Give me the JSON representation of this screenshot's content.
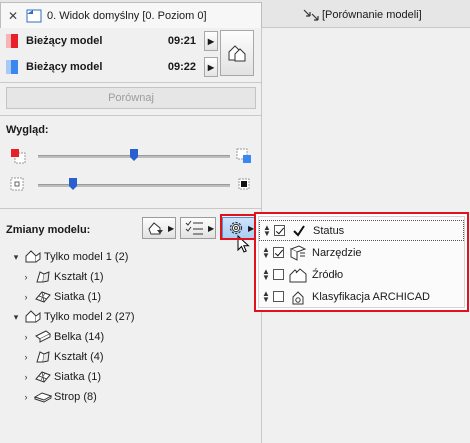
{
  "tabs": {
    "active": {
      "label": "0. Widok domyślny [0. Poziom 0]",
      "close": "✕"
    },
    "inactive": {
      "label": "[Porównanie modeli]"
    }
  },
  "models": [
    {
      "label": "Bieżący model",
      "time": "09:21",
      "color": "#e8202a"
    },
    {
      "label": "Bieżący model",
      "time": "09:22",
      "color": "#3b86f0"
    }
  ],
  "compare_button": "Porównaj",
  "appearance": {
    "label": "Wygląd:",
    "slider1": 0.5,
    "slider2": 0.18
  },
  "changes": {
    "label": "Zmiany modelu:"
  },
  "tree": [
    {
      "level": 0,
      "expand": "▾",
      "label": "Tylko model 1 (2)",
      "icon": "model-icon"
    },
    {
      "level": 1,
      "expand": "›",
      "label": "Kształt (1)",
      "icon": "shape-icon"
    },
    {
      "level": 1,
      "expand": "›",
      "label": "Siatka (1)",
      "icon": "mesh-icon"
    },
    {
      "level": 0,
      "expand": "▾",
      "label": "Tylko model 2 (27)",
      "icon": "model-icon"
    },
    {
      "level": 1,
      "expand": "›",
      "label": "Belka (14)",
      "icon": "beam-icon"
    },
    {
      "level": 1,
      "expand": "›",
      "label": "Kształt (4)",
      "icon": "shape-icon"
    },
    {
      "level": 1,
      "expand": "›",
      "label": "Siatka (1)",
      "icon": "mesh-icon"
    },
    {
      "level": 1,
      "expand": "›",
      "label": "Strop (8)",
      "icon": "slab-icon"
    }
  ],
  "popup": {
    "items": [
      {
        "label": "Status",
        "checked": true,
        "icon": "checkmark-icon"
      },
      {
        "label": "Narzędzie",
        "checked": true,
        "icon": "tool-icon"
      },
      {
        "label": "Źródło",
        "checked": false,
        "icon": "source-icon"
      },
      {
        "label": "Klasyfikacja ARCHICAD",
        "checked": false,
        "icon": "classification-icon"
      }
    ]
  }
}
